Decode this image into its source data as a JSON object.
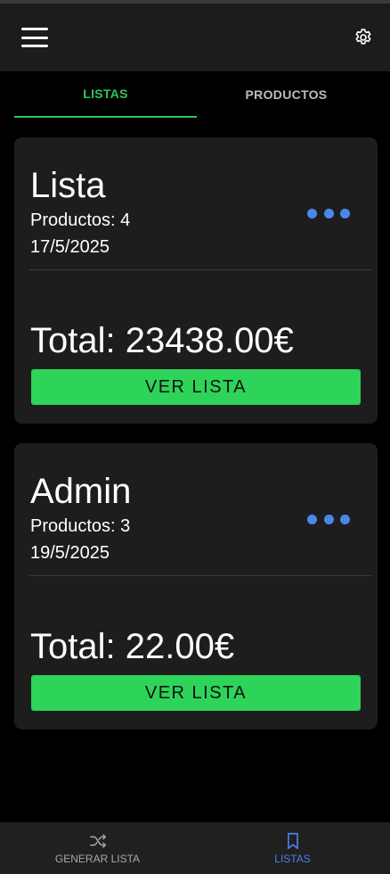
{
  "header": {
    "menu_icon": "hamburger-menu-icon",
    "settings_icon": "gear-icon"
  },
  "tabs": [
    {
      "label": "LISTAS",
      "active": true
    },
    {
      "label": "PRODUCTOS",
      "active": false
    }
  ],
  "lists": [
    {
      "name": "Lista",
      "products": "Productos: 4",
      "date": "17/5/2025",
      "total": "Total: 23438.00€",
      "button_label": "VER LISTA"
    },
    {
      "name": "Admin",
      "products": "Productos: 3",
      "date": "19/5/2025",
      "total": "Total: 22.00€",
      "button_label": "VER LISTA"
    }
  ],
  "bottom_nav": [
    {
      "label": "GENERAR LISTA",
      "icon": "shuffle-icon",
      "active": false
    },
    {
      "label": "LISTAS",
      "icon": "bookmark-icon",
      "active": true
    }
  ],
  "colors": {
    "accent_green": "#2ed35a",
    "accent_blue": "#4b82ea",
    "background": "#000000",
    "card": "#1d1d1d"
  }
}
